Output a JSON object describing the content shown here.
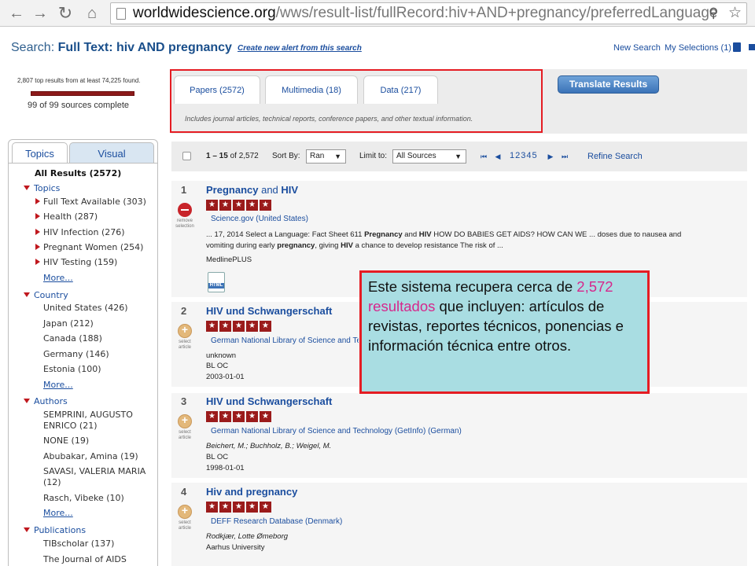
{
  "browser": {
    "url_host": "worldwidescience.org",
    "url_path": "/wws/result-list/fullRecord:hiv+AND+pregnancy/preferredLanguage"
  },
  "header": {
    "search_label": "Search:",
    "search_query": "Full Text: hiv AND pregnancy",
    "alert_link": "Create new alert from this search",
    "new_search": "New Search",
    "my_selections": "My Selections (1)"
  },
  "status": {
    "found": "2,807 top results from at least 74,225 found.",
    "sources": "99 of 99 sources complete",
    "progress": 1.0
  },
  "tabs": [
    {
      "label": "Papers (2572)"
    },
    {
      "label": "Multimedia (18)"
    },
    {
      "label": "Data (217)"
    }
  ],
  "tab_description": "Includes journal articles, technical reports, conference papers, and other textual information.",
  "translate_button": "Translate Results",
  "sidebar": {
    "tabs": [
      "Topics",
      "Visual"
    ],
    "all_results": "All Results (2572)",
    "groups": [
      {
        "label": "Topics",
        "items": [
          "Full Text Available (303)",
          "Health (287)",
          "HIV Infection (276)",
          "Pregnant Women (254)",
          "HIV Testing (159)"
        ],
        "more": "More..."
      },
      {
        "label": "Country",
        "items": [
          "United States (426)",
          "Japan (212)",
          "Canada (188)",
          "Germany (146)",
          "Estonia (100)"
        ],
        "more": "More..."
      },
      {
        "label": "Authors",
        "items": [
          "SEMPRINI, AUGUSTO",
          "ENRICO (21)",
          "NONE (19)",
          "Abubakar, Amina (19)",
          "SAVASI, VALERIA MARIA",
          "(12)",
          "Rasch, Vibeke (10)"
        ],
        "more": "More..."
      },
      {
        "label": "Publications",
        "items": [
          "TIBscholar (137)",
          "The Journal of AIDS"
        ]
      }
    ]
  },
  "toolbar": {
    "range_a": "1 – 15",
    "range_b": "of 2,572",
    "sort_label": "Sort By:",
    "sort_value": "Ran",
    "limit_label": "Limit to:",
    "limit_value": "All Sources",
    "pages": "12345",
    "refine": "Refine Search"
  },
  "results": [
    {
      "num": "1",
      "title_a": "Pregnancy",
      "title_b": " and ",
      "title_c": "HIV",
      "source": "Science.gov (United States)",
      "snippet": "... 17, 2014 Select a Language: Fact Sheet 611 Pregnancy and HIV HOW DO BABIES GET AIDS? HOW CAN WE ... doses due to nausea and vomiting during early pregnancy, giving HIV a chance to develop resistance The risk of ...",
      "meta": [
        "MedlinePLUS"
      ],
      "icon_caption": "remove selection",
      "rating": 5
    },
    {
      "num": "2",
      "title_a": "HIV",
      "title_b": " und ",
      "title_c": "Schwangerschaft",
      "source": "German National Library of Science and Technology (GetInfo) (German)",
      "meta": [
        "unknown",
        "BL OC",
        "2003-01-01"
      ],
      "icon_caption": "select article",
      "rating": 5
    },
    {
      "num": "3",
      "title_a": "HIV",
      "title_b": " und ",
      "title_c": "Schwangerschaft",
      "source": "German National Library of Science and Technology (GetInfo) (German)",
      "meta": [
        "Beichert, M.; Buchholz, B.; Weigel, M.",
        "BL OC",
        "1998-01-01"
      ],
      "icon_caption": "select article",
      "rating": 5
    },
    {
      "num": "4",
      "title_a": "Hiv",
      "title_b": " and ",
      "title_c": "pregnancy",
      "source": "DEFF Research Database (Denmark)",
      "meta": [
        "Rodkjær, Lotte Ømeborg",
        "Aarhus University"
      ],
      "icon_caption": "select article",
      "rating": 5
    }
  ],
  "html_badge": "HTML",
  "annotation": {
    "part1": "Este sistema recupera cerca de ",
    "highlight": "2,572 resultados",
    "part2": " que incluyen: artículos de revistas, reportes técnicos, ponencias e información técnica entre otros."
  }
}
